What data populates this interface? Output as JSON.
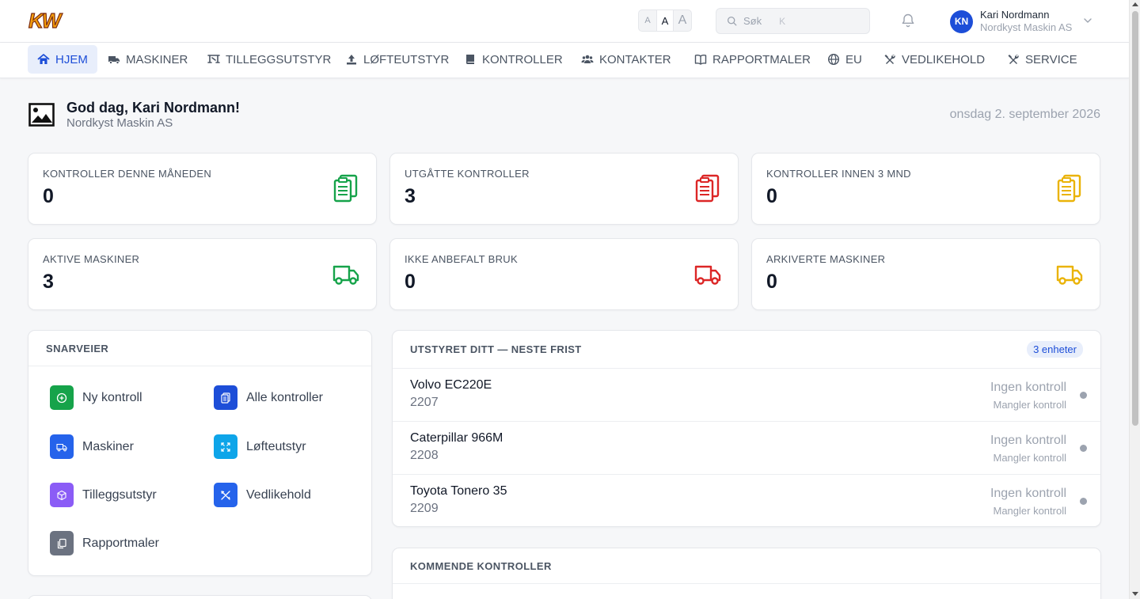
{
  "header": {
    "logo_text": "KW",
    "font_sizes": [
      "A",
      "A",
      "A"
    ],
    "search": {
      "placeholder": "Søk",
      "shortcut": "K"
    },
    "user": {
      "initials": "KN",
      "name": "Kari Nordmann",
      "org": "Nordkyst Maskin AS"
    }
  },
  "nav": [
    {
      "label": "HJEM",
      "icon": "home-icon",
      "active": true
    },
    {
      "label": "MASKINER",
      "icon": "truck-icon"
    },
    {
      "label": "TILLEGGSUTSTYR",
      "icon": "attachment-icon"
    },
    {
      "label": "LØFTEUTSTYR",
      "icon": "lift-icon"
    },
    {
      "label": "KONTROLLER",
      "icon": "book-icon"
    },
    {
      "label": "KONTAKTER",
      "icon": "users-icon"
    },
    {
      "label": "RAPPORTMALER",
      "icon": "open-book-icon"
    },
    {
      "label": "EU",
      "icon": "globe-icon"
    },
    {
      "label": "VEDLIKEHOLD",
      "icon": "tools-icon"
    },
    {
      "label": "SERVICE",
      "icon": "tools-icon"
    }
  ],
  "greeting": {
    "title": "God dag, Kari Nordmann!",
    "org": "Nordkyst Maskin AS",
    "date": "onsdag 2. september 2026"
  },
  "stats": [
    {
      "label": "KONTROLLER DENNE MÅNEDEN",
      "value": "0",
      "icon": "clipboard-icon",
      "color": "#16a34a"
    },
    {
      "label": "UTGÅTTE KONTROLLER",
      "value": "3",
      "icon": "clipboard-icon",
      "color": "#dc2626"
    },
    {
      "label": "KONTROLLER INNEN 3 MND",
      "value": "0",
      "icon": "clipboard-icon",
      "color": "#eab308"
    },
    {
      "label": "AKTIVE MASKINER",
      "value": "3",
      "icon": "truck-icon",
      "color": "#16a34a"
    },
    {
      "label": "IKKE ANBEFALT BRUK",
      "value": "0",
      "icon": "truck-icon",
      "color": "#dc2626"
    },
    {
      "label": "ARKIVERTE MASKINER",
      "value": "0",
      "icon": "truck-icon",
      "color": "#eab308"
    }
  ],
  "shortcuts": {
    "title": "SNARVEIER",
    "items": [
      {
        "label": "Ny kontroll",
        "icon": "plus-circle-icon",
        "color": "#16a34a"
      },
      {
        "label": "Alle kontroller",
        "icon": "clipboard-icon",
        "color": "#1d4ed8"
      },
      {
        "label": "Maskiner",
        "icon": "truck-icon",
        "color": "#2563eb"
      },
      {
        "label": "Løfteutstyr",
        "icon": "expand-icon",
        "color": "#0ea5e9"
      },
      {
        "label": "Tilleggsutstyr",
        "icon": "cube-icon",
        "color": "#8b5cf6"
      },
      {
        "label": "Vedlikehold",
        "icon": "tools-icon",
        "color": "#2563eb"
      },
      {
        "label": "Rapportmaler",
        "icon": "copy-icon",
        "color": "#6b7280"
      }
    ]
  },
  "equipment": {
    "title": "UTSTYRET DITT — NESTE FRIST",
    "badge": "3 enheter",
    "rows": [
      {
        "name": "Volvo EC220E",
        "number": "2207",
        "status": "Ingen kontroll",
        "sub": "Mangler kontroll"
      },
      {
        "name": "Caterpillar 966M",
        "number": "2208",
        "status": "Ingen kontroll",
        "sub": "Mangler kontroll"
      },
      {
        "name": "Toyota Tonero 35",
        "number": "2209",
        "status": "Ingen kontroll",
        "sub": "Mangler kontroll"
      }
    ]
  },
  "upcoming": {
    "title": "KOMMENDE KONTROLLER"
  }
}
